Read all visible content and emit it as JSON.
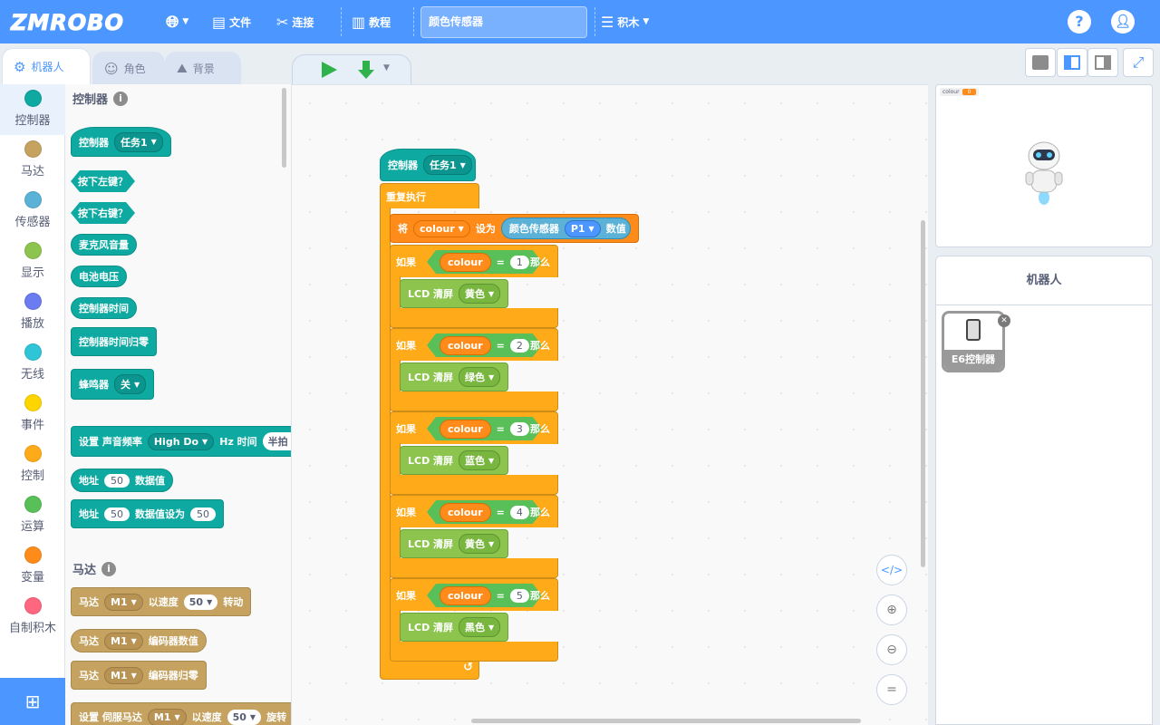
{
  "topbar": {
    "logo": "ZMROBO",
    "file": "文件",
    "connect": "连接",
    "tutorial": "教程",
    "project_name": "颜色传感器",
    "blocks_mode": "积木",
    "help": "?"
  },
  "tabs": {
    "robot": "机器人",
    "role": "角色",
    "background": "背景"
  },
  "categories": [
    {
      "label": "控制器",
      "color": "#0eaaa2"
    },
    {
      "label": "马达",
      "color": "#c5a25f"
    },
    {
      "label": "传感器",
      "color": "#5cb1d6"
    },
    {
      "label": "显示",
      "color": "#8cc44e"
    },
    {
      "label": "播放",
      "color": "#6b7bf0"
    },
    {
      "label": "无线",
      "color": "#2fc4d6"
    },
    {
      "label": "事件",
      "color": "#ffd500"
    },
    {
      "label": "控制",
      "color": "#ffab19"
    },
    {
      "label": "运算",
      "color": "#59c059"
    },
    {
      "label": "变量",
      "color": "#ff8c1a"
    },
    {
      "label": "自制积木",
      "color": "#ff6680"
    }
  ],
  "palette": {
    "section_controller": "控制器",
    "hat_label": "控制器",
    "hat_task": "任务1",
    "left_key": "按下左键？",
    "right_key": "按下右键？",
    "mic": "麦克风音量",
    "battery": "电池电压",
    "timer": "控制器时间",
    "timer_reset": "控制器时间归零",
    "buzzer": "蜂鸣器",
    "buzzer_val": "关",
    "tone_set": "设置 声音频率",
    "tone_note": "High Do",
    "tone_hz": "Hz 时间",
    "tone_beat": "半拍",
    "addr1": "地址",
    "addr1_val": "50",
    "addr1_suffix": "数据值",
    "addr2": "地址",
    "addr2_val": "50",
    "addr2_mid": "数据值设为",
    "addr2_val2": "50",
    "section_motor": "马达",
    "motor_label": "马达",
    "motor_port": "M1",
    "motor_speed_lbl": "以速度",
    "motor_speed": "50",
    "motor_rotate": "转动",
    "enc_label": "马达",
    "enc_port": "M1",
    "enc_val": "编码器数值",
    "encr_label": "马达",
    "encr_port": "M1",
    "encr_reset": "编码器归零",
    "servo_label": "设置 伺服马达",
    "servo_port": "M1",
    "servo_speed_lbl": "以速度",
    "servo_speed": "50",
    "servo_rotate": "旋转"
  },
  "script": {
    "hat_label": "控制器",
    "hat_task": "任务1",
    "forever": "重复执行",
    "set_prefix": "将",
    "var": "colour",
    "set_mid": "设为",
    "sensor": "颜色传感器",
    "port": "P1",
    "value": "数值",
    "if_label": "如果",
    "eq": "=",
    "then": "那么",
    "lcd": "LCD 清屏",
    "branches": [
      {
        "num": "1",
        "color": "黄色"
      },
      {
        "num": "2",
        "color": "绿色"
      },
      {
        "num": "3",
        "color": "蓝色"
      },
      {
        "num": "4",
        "color": "黄色"
      },
      {
        "num": "5",
        "color": "黑色"
      }
    ],
    "loop_arrow": "↺"
  },
  "stage": {
    "monitor_label": "colour",
    "monitor_value": "0"
  },
  "sprites": {
    "header": "机器人",
    "item": "E6控制器"
  }
}
